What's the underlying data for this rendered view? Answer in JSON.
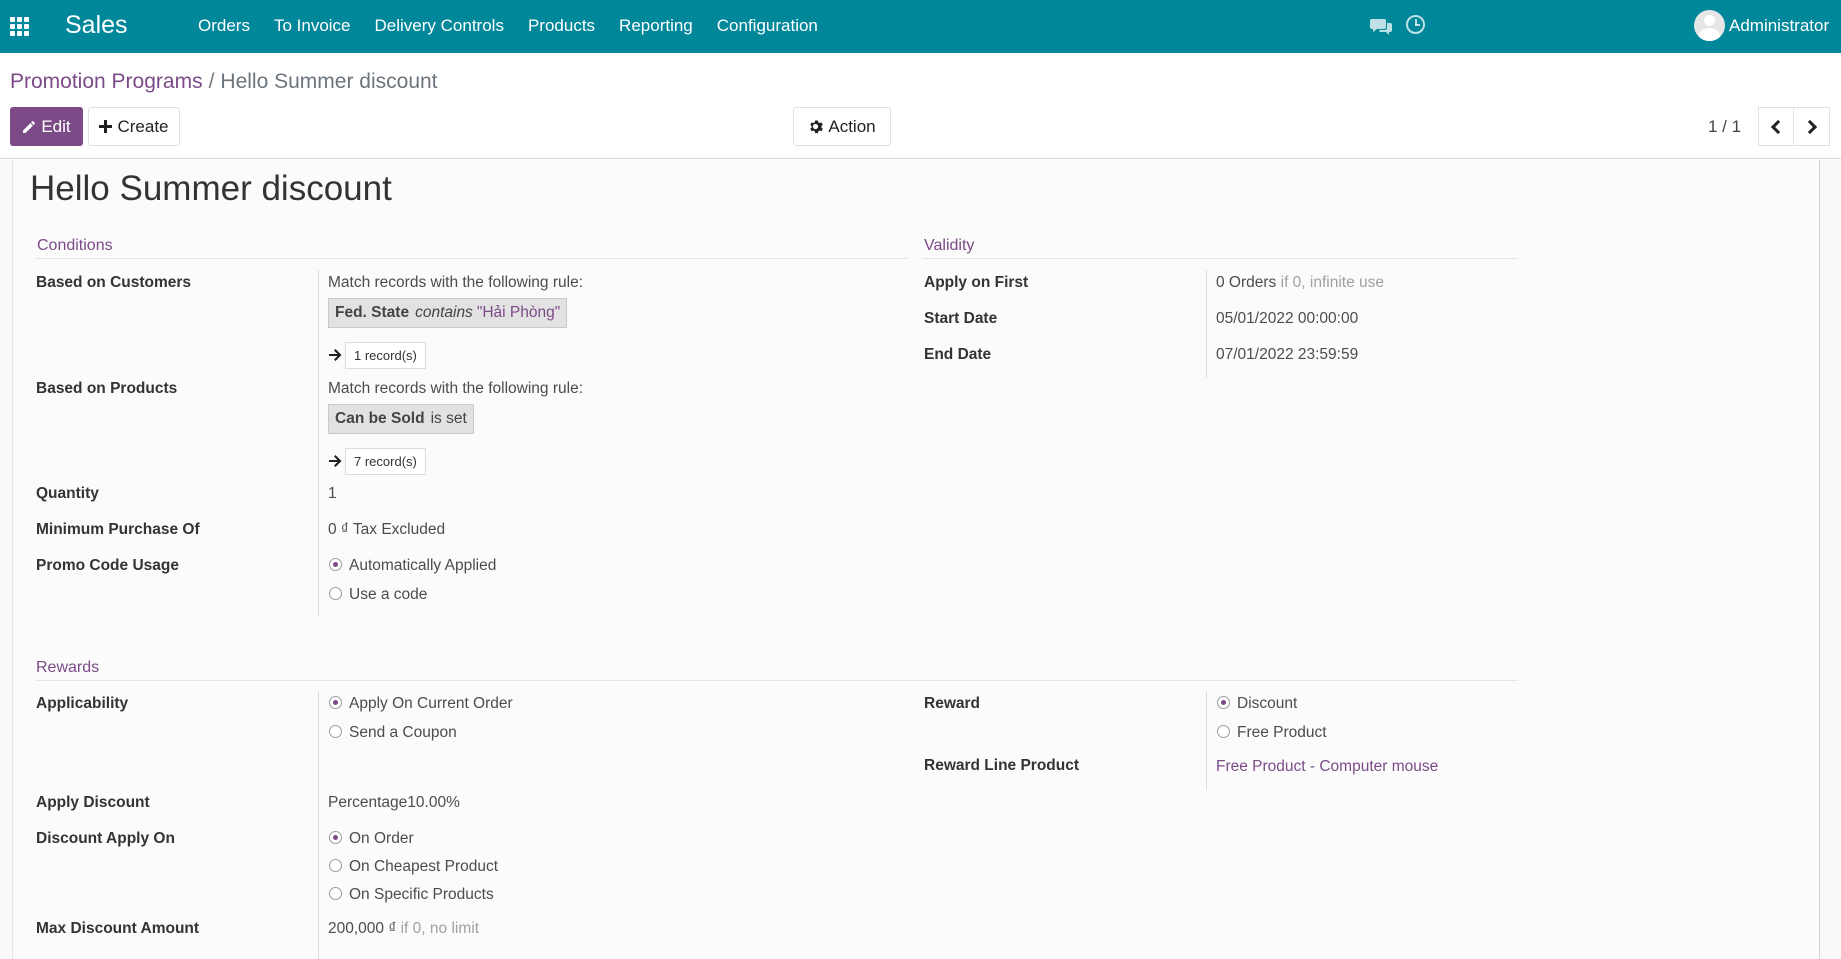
{
  "navbar": {
    "app_name": "Sales",
    "menu": [
      "Orders",
      "To Invoice",
      "Delivery Controls",
      "Products",
      "Reporting",
      "Configuration"
    ],
    "user": "Administrator",
    "color": "#00879a"
  },
  "breadcrumb": {
    "parent": "Promotion Programs",
    "separator": "/",
    "current": "Hello Summer discount"
  },
  "toolbar": {
    "edit_label": "Edit",
    "create_label": "Create",
    "action_label": "Action",
    "pager": "1 / 1"
  },
  "record": {
    "title": "Hello Summer discount",
    "conditions": {
      "heading": "Conditions",
      "customers": {
        "label": "Based on Customers",
        "rule_text": "Match records with the following rule:",
        "rule_field": "Fed. State",
        "rule_operator": "contains",
        "rule_value": "\"Hải Phòng\"",
        "records": "1 record(s)"
      },
      "products": {
        "label": "Based on Products",
        "rule_text": "Match records with the following rule:",
        "rule_field": "Can be Sold",
        "rule_operator": "is set",
        "records": "7 record(s)"
      },
      "quantity": {
        "label": "Quantity",
        "value": "1"
      },
      "min_purchase": {
        "label": "Minimum Purchase Of",
        "value": "0 ₫ Tax Excluded"
      },
      "promo_code": {
        "label": "Promo Code Usage",
        "options": [
          "Automatically Applied",
          "Use a code"
        ],
        "selected": "Automatically Applied"
      }
    },
    "validity": {
      "heading": "Validity",
      "apply_first": {
        "label": "Apply on First",
        "value": "0 Orders",
        "hint": "if 0, infinite use"
      },
      "start_date": {
        "label": "Start Date",
        "value": "05/01/2022 00:00:00"
      },
      "end_date": {
        "label": "End Date",
        "value": "07/01/2022 23:59:59"
      }
    },
    "rewards": {
      "heading": "Rewards",
      "applicability": {
        "label": "Applicability",
        "options": [
          "Apply On Current Order",
          "Send a Coupon"
        ],
        "selected": "Apply On Current Order"
      },
      "apply_discount": {
        "label": "Apply Discount",
        "value": "Percentage10.00%"
      },
      "discount_apply_on": {
        "label": "Discount Apply On",
        "options": [
          "On Order",
          "On Cheapest Product",
          "On Specific Products"
        ],
        "selected": "On Order"
      },
      "max_discount": {
        "label": "Max Discount Amount",
        "value": "200,000 ₫",
        "hint": "if 0, no limit"
      },
      "reward": {
        "label": "Reward",
        "options": [
          "Discount",
          "Free Product"
        ],
        "selected": "Discount"
      },
      "reward_line_product": {
        "label": "Reward Line Product",
        "value": "Free Product - Computer mouse"
      }
    }
  },
  "colors": {
    "primary": "#7c4b87",
    "navbar": "#00879a"
  },
  "icons": [
    "apps-grid-icon",
    "chat-icon",
    "clock-icon",
    "pencil-icon",
    "plus-icon",
    "gear-icon",
    "chevron-left-icon",
    "chevron-right-icon",
    "arrow-right-icon"
  ]
}
